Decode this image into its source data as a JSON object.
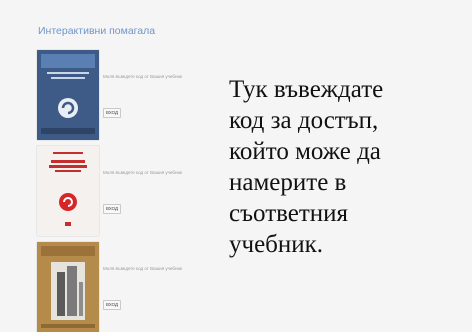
{
  "section": {
    "title": "Интерактивни помагала"
  },
  "items": [
    {
      "hint": "Моля въведете код от Вашия учебник",
      "enter_label": "ВХОД",
      "cover_color": "#3e5a86"
    },
    {
      "hint": "Моля въведете код от Вашия учебник",
      "enter_label": "ВХОД",
      "cover_color": "#f4f1ee"
    },
    {
      "hint": "Моля въведете код от Вашия учебник",
      "enter_label": "ВХОД",
      "cover_color": "#b58b4b"
    }
  ],
  "annotation": {
    "lines": [
      "Тук въвеждате",
      "код за достъп,",
      "който може да",
      "намерите в",
      "съответния",
      "учебник."
    ]
  }
}
